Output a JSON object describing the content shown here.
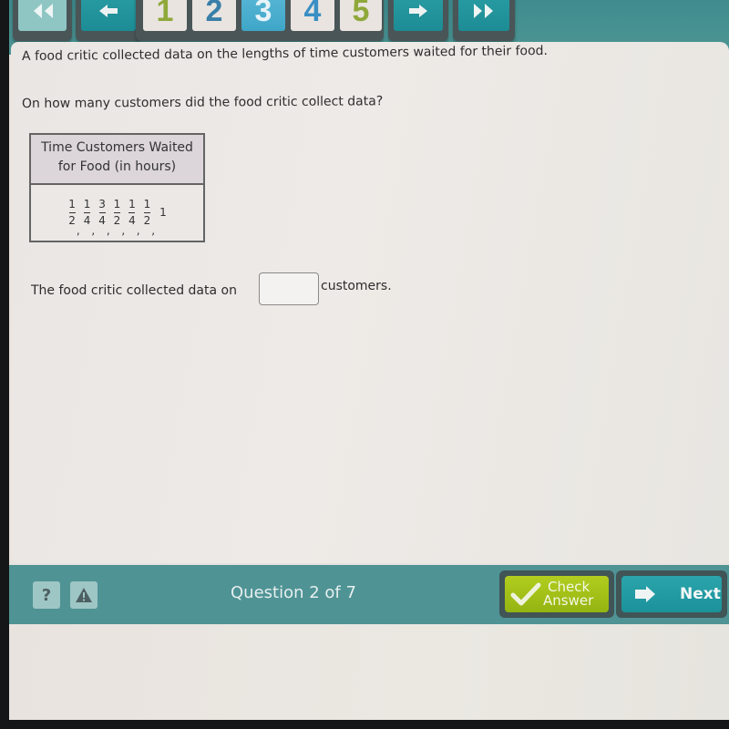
{
  "nav": {
    "first_icon": "double-left-arrow",
    "prev_icon": "left-arrow",
    "next_icon": "right-arrow",
    "last_icon": "double-right-arrow",
    "questions": [
      {
        "label": "1",
        "color": "#8fa83a",
        "active": false
      },
      {
        "label": "2",
        "color": "#3a7fa8",
        "active": false
      },
      {
        "label": "3",
        "color": "#e6f3f8",
        "active": true
      },
      {
        "label": "4",
        "color": "#3a8fc4",
        "active": false
      },
      {
        "label": "5",
        "color": "#8fa83a",
        "active": false
      }
    ]
  },
  "question": {
    "prompt": "A food critic collected data on the lengths of time customers waited for their food.",
    "ask": "On how many customers did the food critic collect data?",
    "table": {
      "header_line1": "Time Customers Waited",
      "header_line2": "for Food (in hours)",
      "values": [
        {
          "num": "1",
          "den": "2"
        },
        {
          "num": "1",
          "den": "4"
        },
        {
          "num": "3",
          "den": "4"
        },
        {
          "num": "1",
          "den": "2"
        },
        {
          "num": "1",
          "den": "4"
        },
        {
          "num": "1",
          "den": "2"
        },
        {
          "whole": "1"
        }
      ]
    },
    "answer_prefix": "The food critic collected data on",
    "answer_value": "",
    "answer_suffix": "customers."
  },
  "footer": {
    "help_label": "?",
    "help_icon": "question-mark",
    "report_icon": "warning-triangle",
    "question_counter": "Question 2 of 7",
    "check_line1": "Check",
    "check_line2": "Answer",
    "check_icon": "checkmark",
    "next_label": "Next",
    "next_icon": "right-arrow",
    "colors": {
      "check": "#a4c21a",
      "next": "#23999f",
      "bar": "#4f9395"
    }
  }
}
